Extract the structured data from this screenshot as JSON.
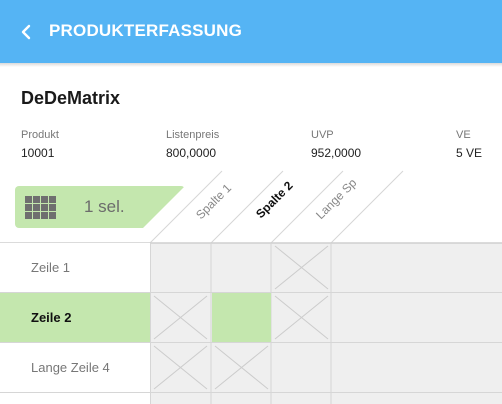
{
  "header": {
    "title": "PRODUKTERFASSUNG",
    "back_icon": "chevron-left-icon",
    "color": "#55b4f4"
  },
  "product": {
    "name": "DeDeMatrix",
    "fields": [
      {
        "label": "Produkt",
        "value": "10001"
      },
      {
        "label": "Listenpreis",
        "value": "800,0000"
      },
      {
        "label": "UVP",
        "value": "952,0000"
      },
      {
        "label": "VE",
        "value": "5 VE"
      }
    ]
  },
  "selection": {
    "icon": "grid-icon",
    "label": "1 sel.",
    "color": "#c4e7ae"
  },
  "matrix": {
    "columns": [
      {
        "label": "Spalte 1",
        "active": false
      },
      {
        "label": "Spalte 2",
        "active": true
      },
      {
        "label": "Lange Sp",
        "active": false
      }
    ],
    "rows": [
      {
        "label": "Zeile 1",
        "active": false,
        "cells": [
          "empty",
          "empty",
          "unavailable"
        ]
      },
      {
        "label": "Zeile 2",
        "active": true,
        "cells": [
          "unavailable",
          "selected",
          "unavailable"
        ]
      },
      {
        "label": "Lange Zeile 4",
        "active": false,
        "cells": [
          "unavailable",
          "unavailable",
          "empty"
        ]
      }
    ],
    "colors": {
      "cell_bg": "#efefef",
      "grid_line": "#d6d6d6",
      "selected": "#c4e7ae",
      "cross": "#cccccc"
    }
  }
}
